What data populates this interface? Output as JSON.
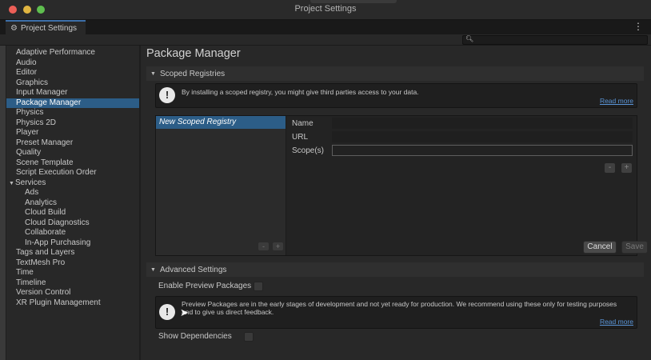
{
  "window": {
    "title": "Project Settings",
    "tab_label": "Project Settings"
  },
  "sidebar": {
    "items": [
      {
        "label": "Adaptive Performance"
      },
      {
        "label": "Audio"
      },
      {
        "label": "Editor"
      },
      {
        "label": "Graphics"
      },
      {
        "label": "Input Manager"
      },
      {
        "label": "Package Manager",
        "selected": true
      },
      {
        "label": "Physics"
      },
      {
        "label": "Physics 2D"
      },
      {
        "label": "Player"
      },
      {
        "label": "Preset Manager"
      },
      {
        "label": "Quality"
      },
      {
        "label": "Scene Template"
      },
      {
        "label": "Script Execution Order"
      },
      {
        "label": "Services",
        "expanded": true
      },
      {
        "label": "Ads",
        "child": true
      },
      {
        "label": "Analytics",
        "child": true
      },
      {
        "label": "Cloud Build",
        "child": true
      },
      {
        "label": "Cloud Diagnostics",
        "child": true
      },
      {
        "label": "Collaborate",
        "child": true
      },
      {
        "label": "In-App Purchasing",
        "child": true
      },
      {
        "label": "Tags and Layers"
      },
      {
        "label": "TextMesh Pro"
      },
      {
        "label": "Time"
      },
      {
        "label": "Timeline"
      },
      {
        "label": "Version Control"
      },
      {
        "label": "XR Plugin Management"
      }
    ]
  },
  "main": {
    "title": "Package Manager",
    "scoped": {
      "header": "Scoped Registries",
      "info": "By installing a scoped registry, you might give third parties access to your data.",
      "read_more": "Read more",
      "registries": [
        "New Scoped Registry"
      ],
      "name_label": "Name",
      "url_label": "URL",
      "scopes_label": "Scope(s)",
      "name_value": "",
      "url_value": "",
      "scopes_value": "",
      "minus": "-",
      "plus": "+",
      "cancel": "Cancel",
      "save": "Save"
    },
    "advanced": {
      "header": "Advanced Settings",
      "enable_preview_label": "Enable Preview Packages",
      "enable_preview_checked": false,
      "info_line1": "Preview Packages are in the early stages of development and not yet ready for production. We recommend using these only for testing purposes",
      "info_line2": "and to give us direct feedback.",
      "read_more": "Read more",
      "show_deps_label": "Show Dependencies",
      "show_deps_checked": false
    }
  },
  "icons": {
    "gear": "gear-icon",
    "search": "search-icon",
    "info": "info-icon",
    "kebab": "more-menu-icon"
  },
  "colors": {
    "selection": "#2c5d87",
    "link": "#5a95d8"
  }
}
